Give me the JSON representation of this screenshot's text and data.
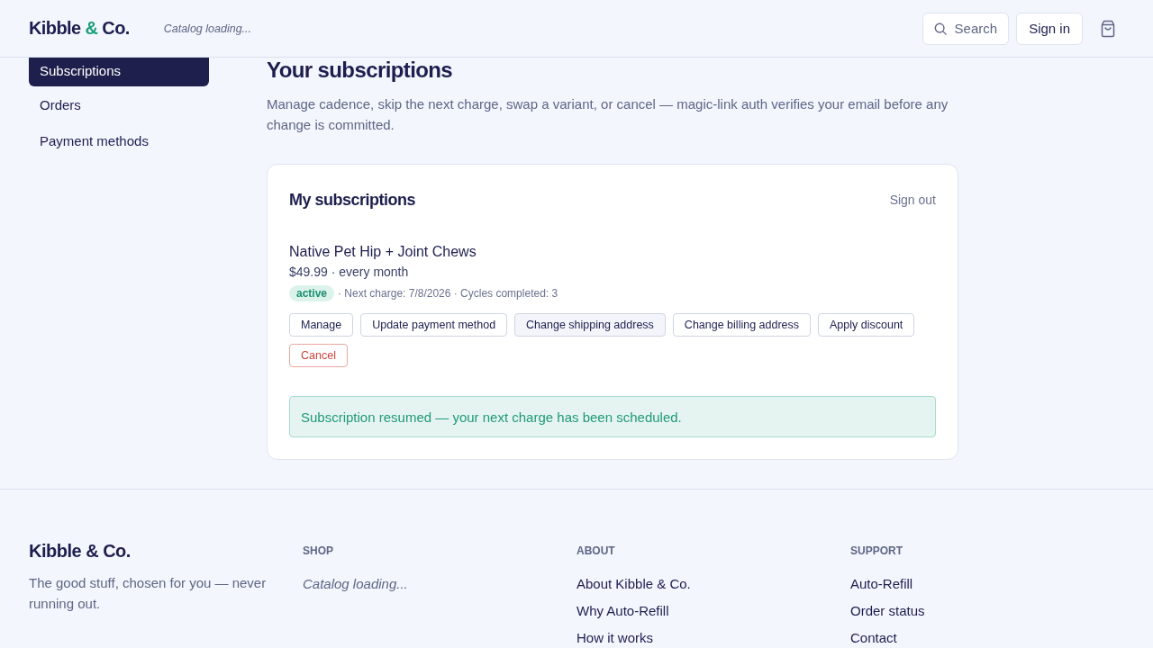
{
  "header": {
    "brand": {
      "parts": [
        {
          "text": "Kibble",
          "accent": false
        },
        {
          "text": "&",
          "accent": true
        },
        {
          "text": "Co.",
          "accent": false
        }
      ]
    },
    "nav_status": "Catalog loading...",
    "search_button": "Search",
    "sign_in": "Sign in"
  },
  "sidebar": {
    "items": [
      {
        "label": "Subscriptions",
        "selected": true
      },
      {
        "label": "Orders",
        "selected": false
      },
      {
        "label": "Payment methods",
        "selected": false
      }
    ]
  },
  "main": {
    "title": "Your subscriptions",
    "description": "Manage cadence, skip the next charge, swap a variant, or cancel — magic-link auth verifies your email before any change is committed.",
    "card": {
      "title": "My subscriptions",
      "sign_out": "Sign out",
      "subscription": {
        "name": "Native Pet Hip + Joint Chews",
        "price_line": "$49.99 · every month",
        "status": "active",
        "meta": "· Next charge: 7/8/2026 · Cycles completed: 3",
        "actions": [
          {
            "label": "Manage",
            "kind": "default",
            "highlighted": false
          },
          {
            "label": "Update payment method",
            "kind": "default",
            "highlighted": false
          },
          {
            "label": "Change shipping address",
            "kind": "default",
            "highlighted": true
          },
          {
            "label": "Change billing address",
            "kind": "default",
            "highlighted": false
          },
          {
            "label": "Apply discount",
            "kind": "default",
            "highlighted": false
          },
          {
            "label": "Cancel",
            "kind": "danger",
            "highlighted": false
          }
        ]
      },
      "notice": {
        "kind": "success",
        "text": "Subscription resumed — your next charge has been scheduled."
      }
    }
  },
  "footer": {
    "brand": "Kibble & Co.",
    "tagline": "The good stuff, chosen for you — never running out.",
    "columns": [
      {
        "heading": "SHOP",
        "status": "Catalog loading..."
      },
      {
        "heading": "ABOUT",
        "links": [
          "About Kibble & Co.",
          "Why Auto-Refill",
          "How it works"
        ]
      },
      {
        "heading": "SUPPORT",
        "links": [
          "Auto-Refill",
          "Order status",
          "Contact"
        ]
      }
    ]
  }
}
